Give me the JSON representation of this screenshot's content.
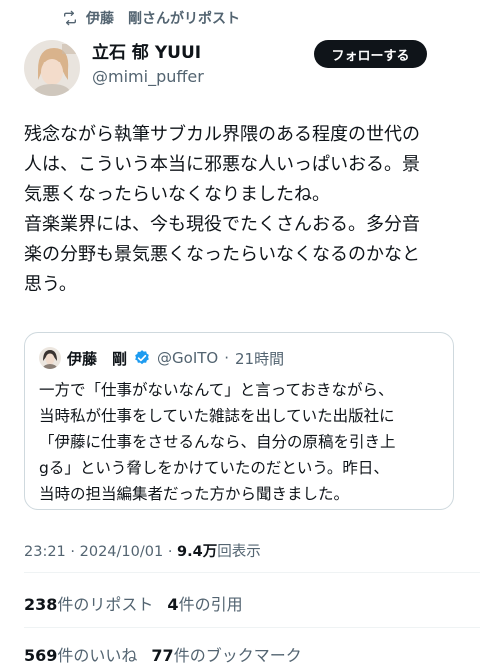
{
  "repost": {
    "label": "伊藤　剛さんがリポスト"
  },
  "author": {
    "name": "立石 郁 YUUI",
    "handle": "@mimi_puffer"
  },
  "follow_button": {
    "label": "フォローする"
  },
  "tweet": {
    "text": "残念ながら執筆サブカル界隈のある程度の世代の\n人は、こういう本当に邪悪な人いっぱいおる。景\n気悪くなったらいなくなりましたね。\n音楽業界には、今も現役でたくさんおる。多分音\n楽の分野も景気悪くなったらいなくなるのかなと\n思う。"
  },
  "quote": {
    "name": "伊藤　剛",
    "handle": "@GoITO",
    "separator": "·",
    "time": "21時間",
    "text": "一方で「仕事がないなんて」と言っておきながら、\n当時私が仕事をしていた雑誌を出していた出版社に\n「伊藤に仕事をさせるんなら、自分の原稿を引き上\ngる」という脅しをかけていたのだという。昨日、\n当時の担当編集者だった方から聞きました。"
  },
  "meta": {
    "time": "23:21",
    "separator": "·",
    "date": "2024/10/01",
    "views_count": "9.4万",
    "views_label": "回表示"
  },
  "stats": {
    "reposts_count": "238",
    "reposts_label": "件のリポスト",
    "quotes_count": "4",
    "quotes_label": "件の引用",
    "likes_count": "569",
    "likes_label": "件のいいね",
    "bookmarks_count": "77",
    "bookmarks_label": "件のブックマーク"
  },
  "colors": {
    "text": "#0f1419",
    "secondary": "#536471",
    "verified": "#1d9bf0",
    "border": "#cfd9de"
  }
}
